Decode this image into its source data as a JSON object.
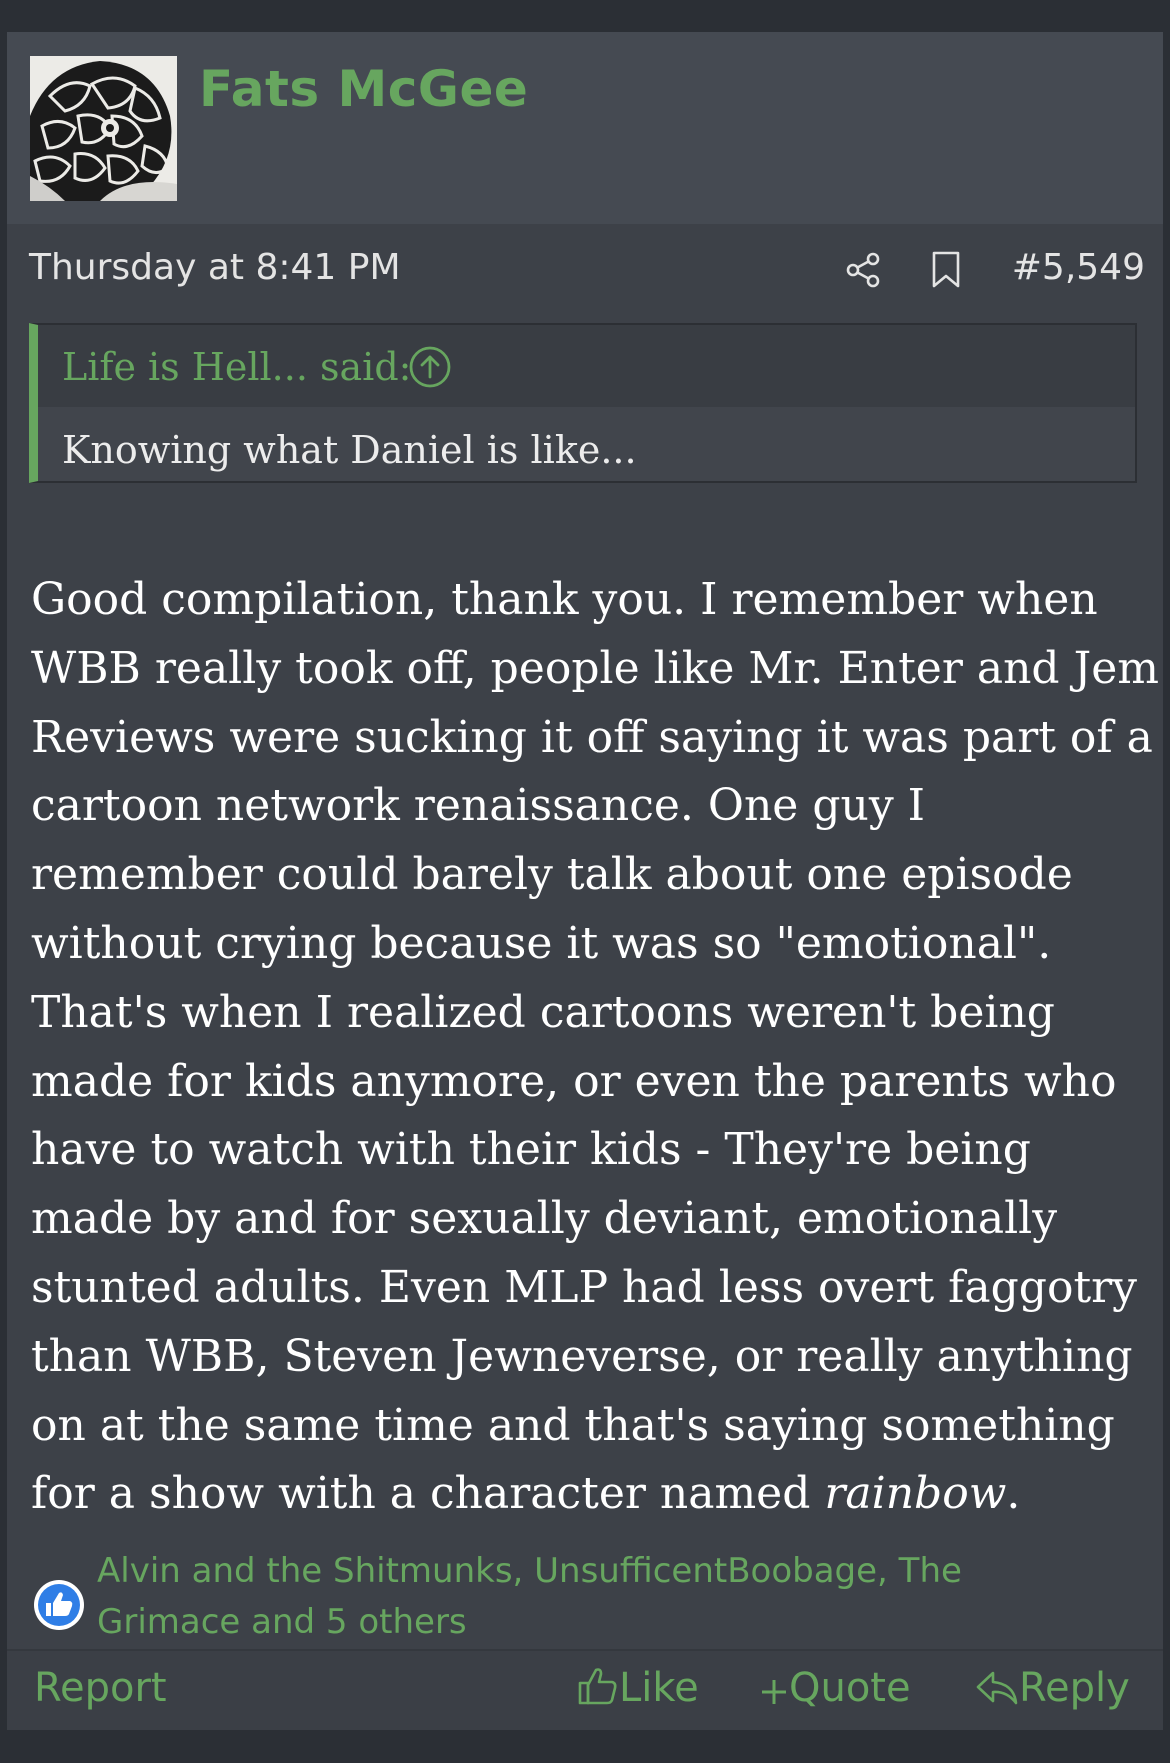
{
  "post": {
    "username": "Fats McGee",
    "date": "Thursday at 8:41 PM",
    "number": "#5,549",
    "quote": {
      "author": "Life is Hell... said:",
      "body": "Knowing what Daniel is like..."
    },
    "message_lines": [
      "Good compilation, thank you. I remember when",
      "WBB really took off, people like Mr. Enter and Jem",
      "Reviews were sucking it off saying it was part of a",
      "cartoon network renaissance. One guy I",
      "remember could barely talk about one episode",
      "without crying because it was so \"emotional\".",
      "That's when I realized cartoons weren't being",
      "made for kids anymore, or even the parents who",
      "have to watch with their kids - They're being",
      "made by and for sexually deviant, emotionally",
      "stunted adults. Even MLP had less overt faggotry",
      "than WBB, Steven Jewneverse, or really anything",
      "on at the same time and that's saying something"
    ],
    "message_last_line_prefix": "for a show with a character named ",
    "message_last_line_emphasis": "rainbow",
    "message_last_line_suffix": ".",
    "reactions": {
      "line1": "Alvin and the Shitmunks, UnsufficentBoobage, The",
      "line2": "Grimace and 5 others"
    },
    "footer": {
      "report": "Report",
      "like": "Like",
      "quote": "Quote",
      "reply": "Reply"
    }
  },
  "colors": {
    "accent": "#67a65f",
    "post_bg": "#3d4148",
    "header_bg": "#454a52",
    "page_bg": "#2b2f35",
    "text": "#ffffff",
    "like_blue": "#2f7ee6"
  },
  "icons": {
    "share": "share-icon",
    "bookmark": "bookmark-icon",
    "quote_jump": "arrow-up-circle-icon",
    "reaction": "thumbs-up-badge-icon",
    "like": "thumbs-up-icon",
    "quote": "plus-icon",
    "reply": "reply-arrow-icon"
  }
}
